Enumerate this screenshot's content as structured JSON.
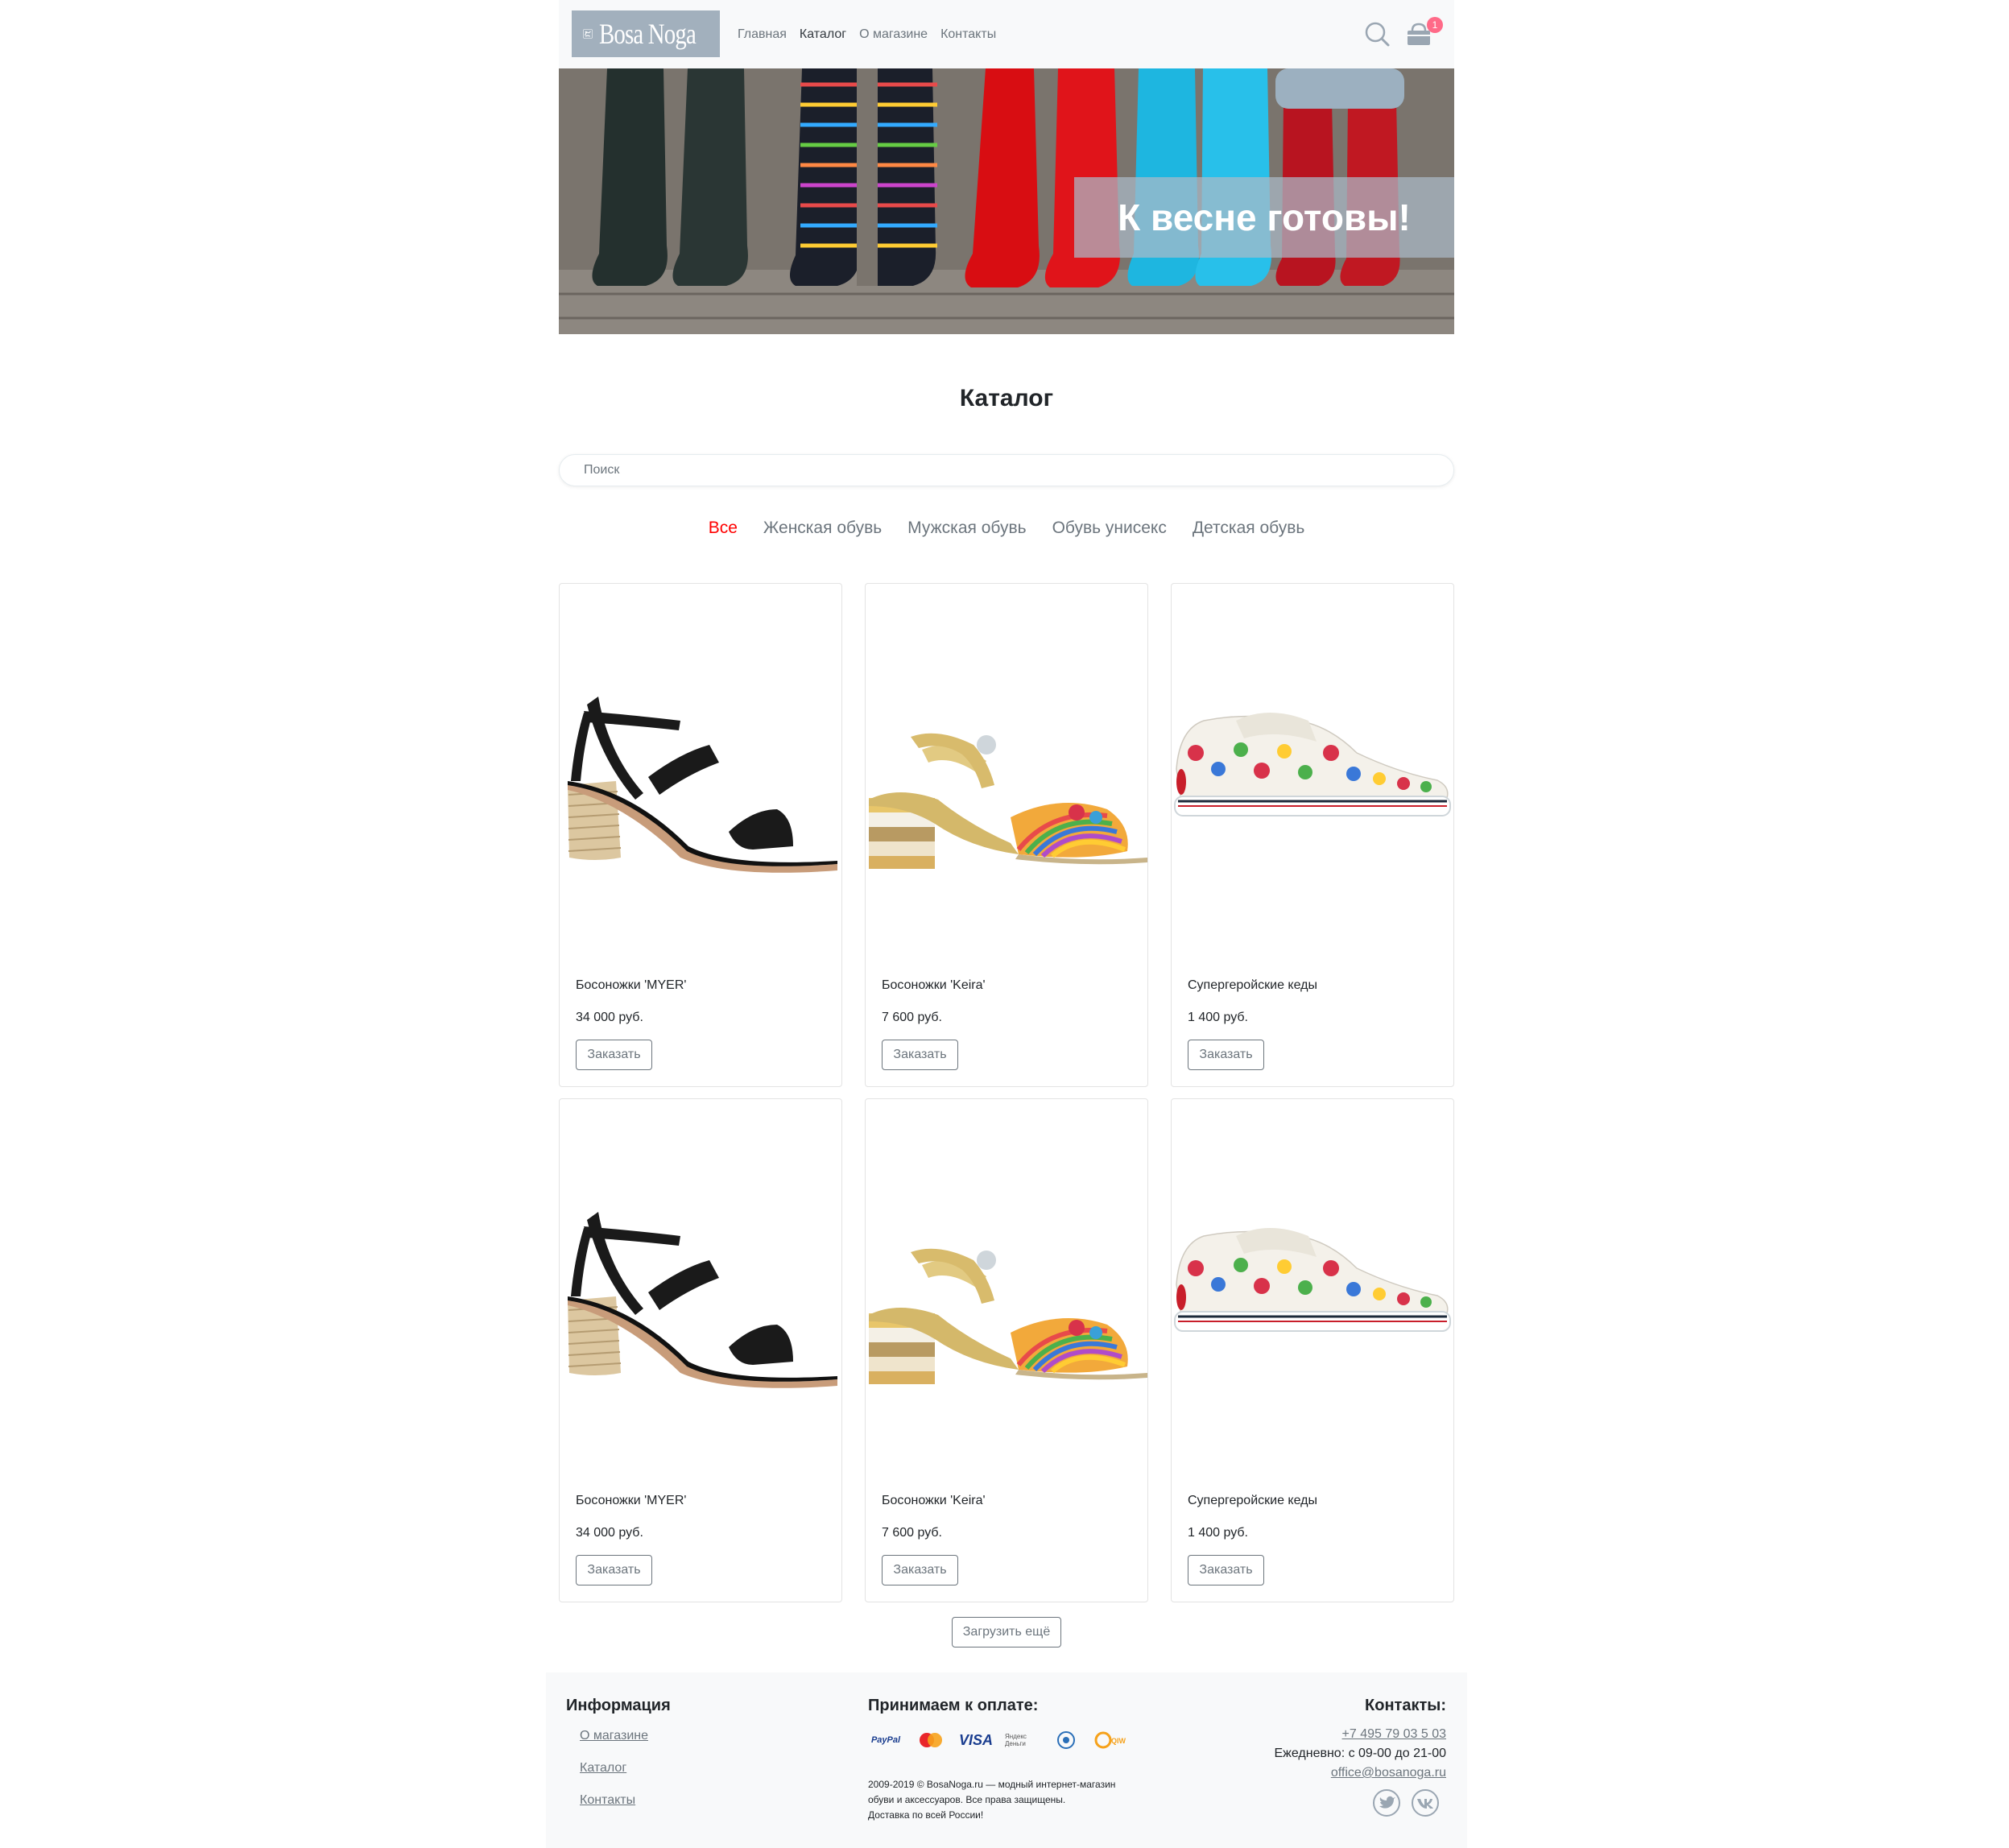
{
  "header": {
    "logo_text": "Bosa Noga",
    "nav": [
      {
        "label": "Главная",
        "active": false
      },
      {
        "label": "Каталог",
        "active": true
      },
      {
        "label": "О магазине",
        "active": false
      },
      {
        "label": "Контакты",
        "active": false
      }
    ],
    "icons": [
      "search-icon",
      "cart-icon"
    ],
    "cart_count": "1"
  },
  "banner": {
    "caption": "К весне готовы!"
  },
  "catalog": {
    "title": "Каталог",
    "search_placeholder": "Поиск",
    "categories": [
      {
        "label": "Все",
        "active": true
      },
      {
        "label": "Женская обувь",
        "active": false
      },
      {
        "label": "Мужская обувь",
        "active": false
      },
      {
        "label": "Обувь унисекс",
        "active": false
      },
      {
        "label": "Детская обувь",
        "active": false
      }
    ],
    "products": [
      {
        "title": "Босоножки 'MYER'",
        "price": "34 000 руб.",
        "button": "Заказать",
        "image": "black-sandal"
      },
      {
        "title": "Босоножки 'Keira'",
        "price": "7 600 руб.",
        "button": "Заказать",
        "image": "gold-sandal"
      },
      {
        "title": "Супергеройские кеды",
        "price": "1 400 руб.",
        "button": "Заказать",
        "image": "hero-sneaker"
      },
      {
        "title": "Босоножки 'MYER'",
        "price": "34 000 руб.",
        "button": "Заказать",
        "image": "black-sandal"
      },
      {
        "title": "Босоножки 'Keira'",
        "price": "7 600 руб.",
        "button": "Заказать",
        "image": "gold-sandal"
      },
      {
        "title": "Супергеройские кеды",
        "price": "1 400 руб.",
        "button": "Заказать",
        "image": "hero-sneaker"
      }
    ],
    "load_more": "Загрузить ещё"
  },
  "footer": {
    "info_title": "Информация",
    "info_links": [
      "О магазине",
      "Каталог",
      "Контакты"
    ],
    "payment_title": "Принимаем к оплате:",
    "payment_methods": [
      "PayPal",
      "MasterCard",
      "VISA",
      "Яндекс Деньги",
      "WebMoney",
      "QIWI"
    ],
    "copyright": [
      "2009-2019 © BosaNoga.ru — модный интернет-магазин",
      "обуви и аксессуаров. Все права защищены.",
      "Доставка по всей России!"
    ],
    "contacts_title": "Контакты:",
    "phone": "+7 495 79 03 5 03",
    "hours": "Ежедневно: с 09-00 до 21-00",
    "email": "office@bosanoga.ru",
    "social": [
      "twitter-icon",
      "vk-icon"
    ]
  },
  "colors": {
    "header_bg": "#f8f9fa",
    "logo_bg": "#a2b0bd",
    "active_category": "#ff0000",
    "badge": "#ff6a88",
    "muted": "#6c757d"
  }
}
